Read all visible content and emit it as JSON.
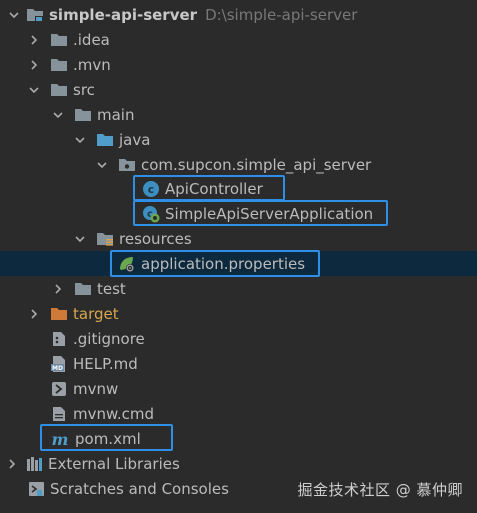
{
  "project": {
    "name": "simple-api-server",
    "path": "D:\\simple-api-server"
  },
  "tree": {
    "idea": ".idea",
    "mvn": ".mvn",
    "src": "src",
    "main": "main",
    "java": "java",
    "package": "com.supcon.simple_api_server",
    "api_controller": "ApiController",
    "app_class": "SimpleApiServerApplication",
    "resources": "resources",
    "app_properties": "application.properties",
    "test": "test",
    "target": "target",
    "gitignore": ".gitignore",
    "help": "HELP.md",
    "mvnw": "mvnw",
    "mvnw_cmd": "mvnw.cmd",
    "pom": "pom.xml",
    "external_libraries": "External Libraries",
    "scratches": "Scratches and Consoles"
  },
  "icons": {
    "md_badge": "MD",
    "pom_badge": "m"
  },
  "watermark": "掘金技术社区 @ 慕仲卿",
  "colors": {
    "background": "#2b2b2b",
    "selection": "#0d293e",
    "highlight_border": "#2f8fe6",
    "folder": "#87939a",
    "source_folder": "#4f9dc8",
    "excluded_folder": "#d07a3a",
    "text": "#bbbbbb"
  }
}
